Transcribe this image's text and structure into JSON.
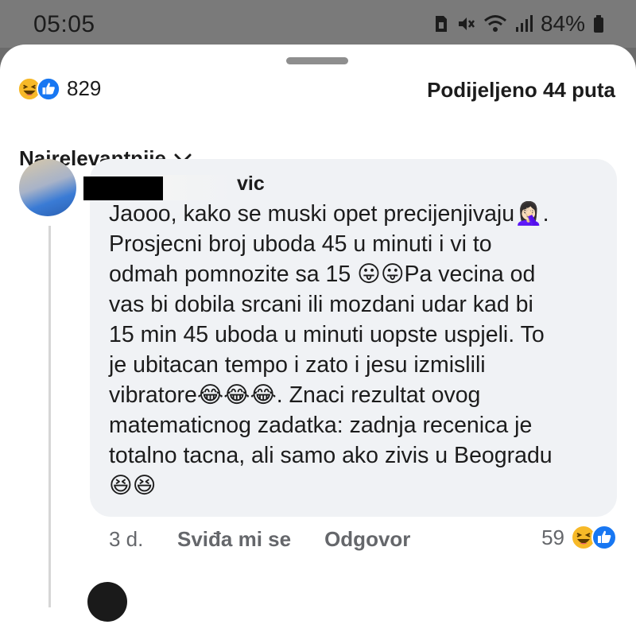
{
  "status_bar": {
    "time": "05:05",
    "battery": "84%",
    "icons": [
      "sim-icon",
      "mute-icon",
      "wifi-icon",
      "signal-icon",
      "battery-icon"
    ]
  },
  "header": {
    "reaction_count": "829",
    "reaction_icons": [
      "haha-icon",
      "like-icon"
    ],
    "shares": "Podijeljeno 44 puta"
  },
  "sort": {
    "label": "Najrelevantnije"
  },
  "comment": {
    "author_visible": "vic",
    "lines": [
      "Jaooo, kako se muski opet precijenjivaju🤦🏻‍♀️.",
      "Prosjecni broj uboda 45 u minuti i vi to",
      "odmah pomnozite sa 15 😛😛Pa vecina od",
      "vas bi dobila srcani ili mozdani udar kad bi",
      "15 min 45 uboda u minuti uopste uspjeli. To",
      "je ubitacan tempo i zato i jesu izmislili",
      "vibratore😂😂😂. Znaci rezultat ovog",
      "matematicnog zadatka: zadnja recenica je",
      "totalno tacna, ali samo ako zivis u Beogradu",
      "😆😆"
    ],
    "time_ago": "3 d.",
    "like_label": "Sviđa mi se",
    "reply_label": "Odgovor",
    "reaction_count": "59",
    "reaction_icons": [
      "haha-icon",
      "like-icon"
    ]
  },
  "colors": {
    "like_blue": "#1877f2",
    "haha_yellow": "#f7b928",
    "bubble_bg": "#f0f2f5",
    "secondary_text": "#65676b"
  }
}
